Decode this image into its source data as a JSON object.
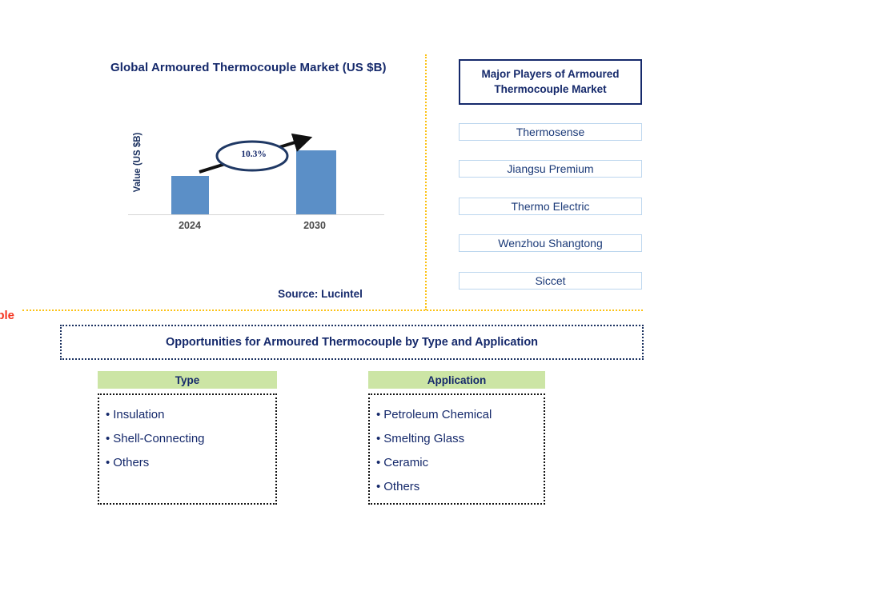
{
  "edge_fragment": "ouple",
  "chart": {
    "title": "Global Armoured Thermocouple Market (US $B)",
    "ylabel": "Value (US $B)",
    "cagr_label": "10.3%",
    "source": "Source: Lucintel"
  },
  "chart_data": {
    "type": "bar",
    "title": "Global Armoured Thermocouple Market (US $B)",
    "categories": [
      "2024",
      "2030"
    ],
    "values": [
      48,
      80
    ],
    "xlabel": "",
    "ylabel": "Value (US $B)",
    "ylim": [
      0,
      100
    ],
    "grid": false,
    "legend": "none",
    "annotations": [
      {
        "text": "10.3%",
        "type": "cagr-callout",
        "from": "2024",
        "to": "2030"
      }
    ],
    "series": [
      {
        "name": "Value (US $B)",
        "values": [
          48,
          80
        ],
        "color": "#5b8fc7"
      }
    ]
  },
  "players": {
    "header": "Major Players of Armoured Thermocouple Market",
    "items": [
      "Thermosense",
      "Jiangsu Premium",
      "Thermo Electric",
      "Wenzhou Shangtong",
      "Siccet"
    ]
  },
  "opportunities": {
    "banner": "Opportunities for Armoured Thermocouple by Type and Application",
    "columns": [
      {
        "header": "Type",
        "items": [
          "Insulation",
          "Shell-Connecting",
          "Others"
        ]
      },
      {
        "header": "Application",
        "items": [
          "Petroleum Chemical",
          "Smelting Glass",
          "Ceramic",
          "Others"
        ]
      }
    ]
  },
  "colors": {
    "navy": "#15296b",
    "bar_blue": "#5b8fc7",
    "divider_gold": "#fcc215",
    "header_green": "#cce5a5",
    "player_border": "#bcd6ee",
    "fragment_red": "#f5341f"
  }
}
